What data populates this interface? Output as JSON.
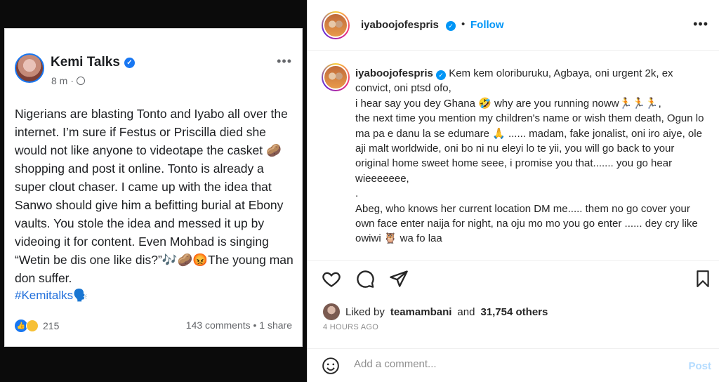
{
  "facebook_post": {
    "author": "Kemi Talks",
    "time": "8 m",
    "body": "Nigerians are blasting Tonto and Iyabo all over the internet. I’m sure if Festus or Priscilla died she would not like anyone to videotape the casket 🥔 shopping and post it online. Tonto is already a super clout chaser. I came up with the idea that Sanwo should give him a befitting burial at Ebony vaults. You stole the idea and messed it up by videoing it for content. Even Mohbad is singing “Wetin be dis one like dis?”🎶🥔😡The young man don suffer.",
    "hashtag": "#Kemitalks🗣️",
    "reaction_count": "215",
    "stats": "143 comments • 1 share"
  },
  "instagram": {
    "header_handle": "iyaboojofespris",
    "follow_label": "Follow",
    "caption_handle": "iyaboojofespris",
    "caption_lines": [
      "Kem kem oloriburuku, Agbaya, oni urgent 2k, ex convict, oni ptsd ofo,",
      "i hear say you dey Ghana 🤣 why are you running noww🏃🏃🏃,",
      "the next time you mention my children's name or wish them death, Ogun lo ma pa e danu la se edumare 🙏 ...... madam, fake jonalist, oni iro aiye, ole aji malt worldwide, oni bo ni nu eleyi lo te yii, you will go back to your original home sweet home seee, i promise you that....... you go hear wieeeeeee,",
      ".",
      "Abeg, who knows her current location DM me..... them no go cover your own face enter naija for night, na oju mo mo you go enter ...... dey cry like owiwi 🦉 wa fo laa"
    ],
    "liked_by_prefix": "Liked by",
    "liked_by_user": "teamambani",
    "liked_by_suffix": "and",
    "others_count": "31,754 others",
    "timestamp": "4 HOURS AGO",
    "comment_placeholder": "Add a comment...",
    "post_label": "Post"
  }
}
